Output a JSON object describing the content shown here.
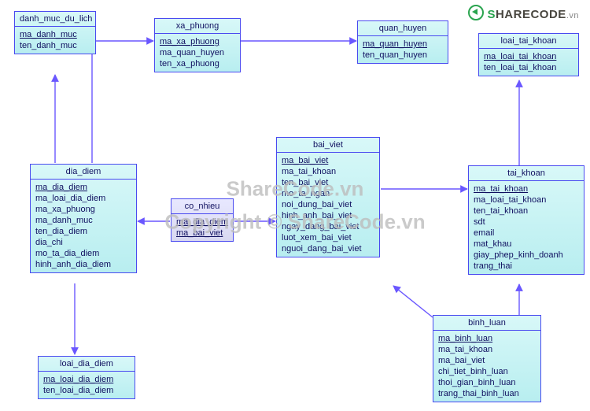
{
  "diagram_type": "entity-relationship",
  "logo": {
    "text": "SHARECODE",
    "suffix": ".vn"
  },
  "watermark": {
    "line1": "ShareCode.vn",
    "line2": "Copyright © ShareCode.vn"
  },
  "entities": {
    "danh_muc_du_lich": {
      "title": "danh_muc_du_lich",
      "attrs": [
        {
          "name": "ma_danh_muc",
          "pk": true
        },
        {
          "name": "ten_danh_muc"
        }
      ]
    },
    "xa_phuong": {
      "title": "xa_phuong",
      "attrs": [
        {
          "name": "ma_xa_phuong",
          "pk": true
        },
        {
          "name": "ma_quan_huyen"
        },
        {
          "name": "ten_xa_phuong"
        }
      ]
    },
    "quan_huyen": {
      "title": "quan_huyen",
      "attrs": [
        {
          "name": "ma_quan_huyen",
          "pk": true
        },
        {
          "name": "ten_quan_huyen"
        }
      ]
    },
    "loai_tai_khoan": {
      "title": "loai_tai_khoan",
      "attrs": [
        {
          "name": "ma_loai_tai_khoan",
          "pk": true
        },
        {
          "name": "ten_loai_tai_khoan"
        }
      ]
    },
    "dia_diem": {
      "title": "dia_diem",
      "attrs": [
        {
          "name": "ma_dia_diem",
          "pk": true
        },
        {
          "name": "ma_loai_dia_diem"
        },
        {
          "name": "ma_xa_phuong"
        },
        {
          "name": "ma_danh_muc"
        },
        {
          "name": "ten_dia_diem"
        },
        {
          "name": "dia_chi"
        },
        {
          "name": "mo_ta_dia_diem"
        },
        {
          "name": "hinh_anh_dia_diem"
        }
      ]
    },
    "co_nhieu": {
      "title": "co_nhieu",
      "attrs": [
        {
          "name": "ma_dia_diem",
          "pk": true
        },
        {
          "name": "ma_bai_viet",
          "pk": true
        }
      ]
    },
    "bai_viet": {
      "title": "bai_viet",
      "attrs": [
        {
          "name": "ma_bai_viet",
          "pk": true
        },
        {
          "name": "ma_tai_khoan"
        },
        {
          "name": "ten_bai_viet"
        },
        {
          "name": "mo_ta_ngan"
        },
        {
          "name": "noi_dung_bai_viet"
        },
        {
          "name": "hinh_anh_bai_viet"
        },
        {
          "name": "ngay_dang_bai_viet"
        },
        {
          "name": "luot_xem_bai_viet"
        },
        {
          "name": "nguoi_dang_bai_viet"
        }
      ]
    },
    "tai_khoan": {
      "title": "tai_khoan",
      "attrs": [
        {
          "name": "ma_tai_khoan",
          "pk": true
        },
        {
          "name": "ma_loai_tai_khoan"
        },
        {
          "name": "ten_tai_khoan"
        },
        {
          "name": "sdt"
        },
        {
          "name": "email"
        },
        {
          "name": "mat_khau"
        },
        {
          "name": "giay_phep_kinh_doanh"
        },
        {
          "name": "trang_thai"
        }
      ]
    },
    "binh_luan": {
      "title": "binh_luan",
      "attrs": [
        {
          "name": "ma_binh_luan",
          "pk": true
        },
        {
          "name": "ma_tai_khoan"
        },
        {
          "name": "ma_bai_viet"
        },
        {
          "name": "chi_tiet_binh_luan"
        },
        {
          "name": "thoi_gian_binh_luan"
        },
        {
          "name": "trang_thai_binh_luan"
        }
      ]
    },
    "loai_dia_diem": {
      "title": "loai_dia_diem",
      "attrs": [
        {
          "name": "ma_loai_dia_diem",
          "pk": true
        },
        {
          "name": "ten_loai_dia_diem"
        }
      ]
    }
  },
  "relationships": [
    {
      "from": "dia_diem",
      "via": "ma_danh_muc",
      "to": "danh_muc_du_lich"
    },
    {
      "from": "dia_diem",
      "via": "ma_xa_phuong",
      "to": "xa_phuong"
    },
    {
      "from": "xa_phuong",
      "via": "ma_quan_huyen",
      "to": "quan_huyen"
    },
    {
      "from": "dia_diem",
      "via": "ma_loai_dia_diem",
      "to": "loai_dia_diem"
    },
    {
      "from": "co_nhieu",
      "via": "ma_dia_diem",
      "to": "dia_diem"
    },
    {
      "from": "co_nhieu",
      "via": "ma_bai_viet",
      "to": "bai_viet"
    },
    {
      "from": "bai_viet",
      "via": "ma_tai_khoan",
      "to": "tai_khoan"
    },
    {
      "from": "binh_luan",
      "via": "ma_bai_viet",
      "to": "bai_viet"
    },
    {
      "from": "binh_luan",
      "via": "ma_tai_khoan",
      "to": "tai_khoan"
    },
    {
      "from": "tai_khoan",
      "via": "ma_loai_tai_khoan",
      "to": "loai_tai_khoan"
    }
  ]
}
